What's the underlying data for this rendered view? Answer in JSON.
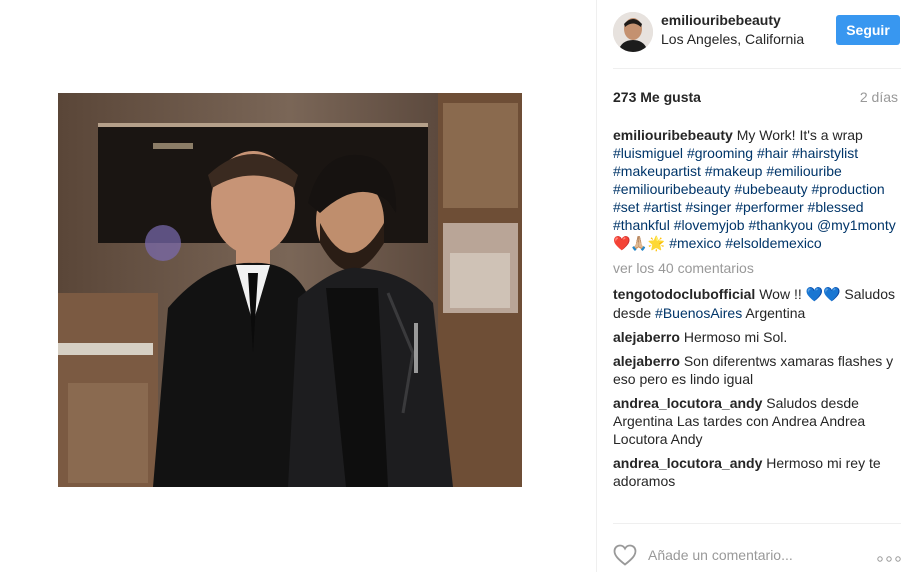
{
  "post": {
    "username": "emiliouribebeauty",
    "location": "Los Angeles, California",
    "follow_label": "Seguir",
    "likes": "273 Me gusta",
    "time_ago": "2 días"
  },
  "caption": {
    "user": "emiliouribebeauty",
    "text": "My Work! It's a wrap",
    "tags": [
      "#luismiguel",
      "#grooming",
      "#hair",
      "#hairstylist",
      "#makeupartist",
      "#makeup",
      "#emiliouribe",
      "#emiliouribebeauty",
      "#ubebeauty",
      "#production",
      "#set",
      "#artist",
      "#singer",
      "#performer",
      "#blessed",
      "#thankful",
      "#lovemyjob",
      "#thankyou",
      "@my1monty"
    ],
    "emojis": "❤️🙏🏼🌟",
    "tags_after": [
      "#mexico",
      "#elsoldemexico"
    ]
  },
  "view_more": "ver los 40 comentarios",
  "comments": [
    {
      "user": "tengotodoclubofficial",
      "pre": "Wow !!",
      "emojis": "💙💙",
      "mid": "Saludos desde",
      "tag": "#BuenosAires",
      "post": "Argentina"
    },
    {
      "user": "alejaberro",
      "text": "Hermoso mi Sol."
    },
    {
      "user": "alejaberro",
      "text": "Son diferentws xamaras flashes y eso pero es lindo igual"
    },
    {
      "user": "andrea_locutora_andy",
      "text": "Saludos desde Argentina Las tardes con Andrea Andrea Locutora Andy"
    },
    {
      "user": "andrea_locutora_andy",
      "text": "Hermoso mi rey te adoramos"
    }
  ],
  "add_comment": {
    "placeholder": "Añade un comentario...",
    "options": "ooo"
  },
  "icons": [
    "heart-icon",
    "options-icon"
  ]
}
